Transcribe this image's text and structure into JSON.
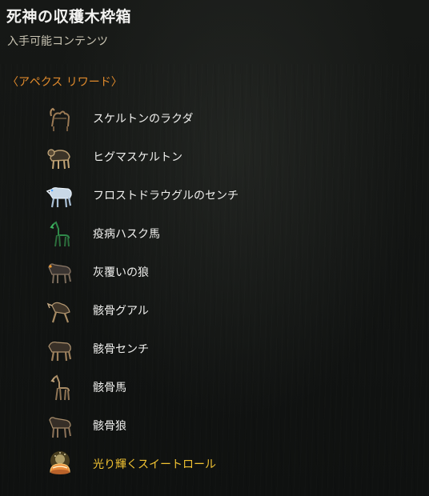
{
  "tooltip": {
    "title": "死神の収穫木枠箱",
    "subtitle": "入手可能コンテンツ",
    "section_label": "〈アペクス リワード〉",
    "items": [
      {
        "label": "スケルトンのラクダ",
        "icon": "skeleton-camel-icon"
      },
      {
        "label": "ヒグマスケルトン",
        "icon": "grizzly-skeleton-icon"
      },
      {
        "label": "フロストドラウグルのセンチ",
        "icon": "frost-draugr-saber-icon"
      },
      {
        "label": "疫病ハスク馬",
        "icon": "plague-husk-horse-icon"
      },
      {
        "label": "灰覆いの狼",
        "icon": "ash-shroud-wolf-icon"
      },
      {
        "label": "骸骨グアル",
        "icon": "bone-guar-icon"
      },
      {
        "label": "骸骨センチ",
        "icon": "bone-senche-icon"
      },
      {
        "label": "骸骨馬",
        "icon": "bone-horse-icon"
      },
      {
        "label": "骸骨狼",
        "icon": "bone-wolf-icon"
      },
      {
        "label": "光り輝くスイートロール",
        "icon": "glowing-sweetroll-icon"
      }
    ]
  },
  "colors": {
    "section": "#e08a2c",
    "highlight_item": "#f1c232"
  }
}
